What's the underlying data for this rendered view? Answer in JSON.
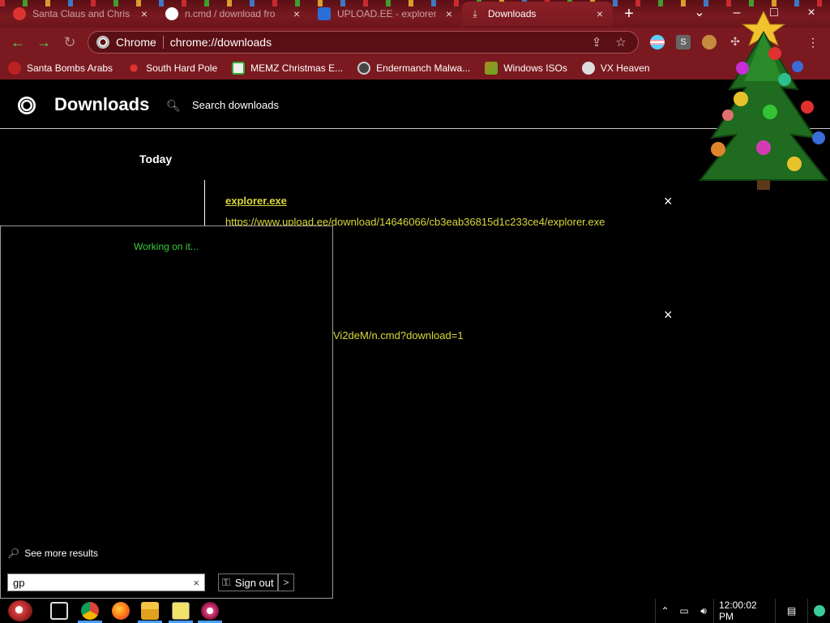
{
  "tabs": [
    {
      "title": "Santa Claus and Chris",
      "close": "×"
    },
    {
      "title": "n.cmd / download fro",
      "close": "×"
    },
    {
      "title": "UPLOAD.EE - explorer",
      "close": "×"
    },
    {
      "title": "Downloads",
      "close": "×"
    }
  ],
  "newtab": "+",
  "window": {
    "minimize": "–",
    "maximize": "□",
    "close": "×"
  },
  "toolbar": {
    "origin": "Chrome",
    "url": "chrome://downloads"
  },
  "bookmarks": [
    {
      "label": "Santa Bombs Arabs"
    },
    {
      "label": "South Hard Pole"
    },
    {
      "label": "MEMZ Christmas E..."
    },
    {
      "label": "Endermanch Malwa..."
    },
    {
      "label": "Windows ISOs"
    },
    {
      "label": "VX Heaven"
    }
  ],
  "page": {
    "title": "Downloads",
    "search_label": "Search downloads",
    "section": "Today",
    "downloads": [
      {
        "name": "explorer.exe",
        "url": "https://www.upload.ee/download/14646066/cb3eab36815d1c233ce4/explorer.exe",
        "remove": "×"
      },
      {
        "name": "",
        "url": "Vi2deM/n.cmd?download=1",
        "remove": "×"
      }
    ]
  },
  "startmenu": {
    "status": "Working on it...",
    "see_more": "See more results",
    "search_value": "gp",
    "clear": "×",
    "sign_out": "Sign out",
    "arrow": ">"
  },
  "taskbar": {
    "clock": "12:00:02 PM"
  },
  "colors": {
    "accent": "#7a1a20",
    "link": "#d8d83a",
    "status": "#3ccc3c"
  }
}
